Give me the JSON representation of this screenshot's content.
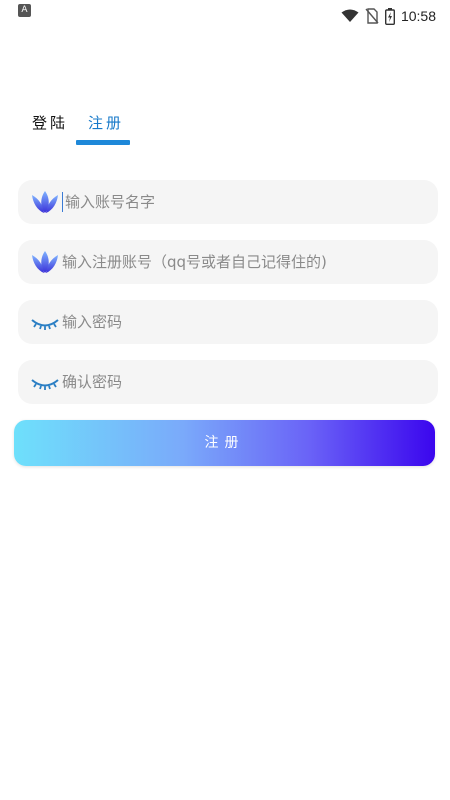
{
  "status_bar": {
    "app_badge": "A",
    "time": "10:58",
    "icons": [
      "wifi-icon",
      "no-sim-icon",
      "battery-charging-icon"
    ]
  },
  "tabs": [
    {
      "label": "登陆",
      "active": false
    },
    {
      "label": "注册",
      "active": true
    }
  ],
  "fields": {
    "account_name": {
      "placeholder": "输入账号名字",
      "icon": "lotus-icon"
    },
    "register_account": {
      "placeholder": "输入注册账号（qq号或者自己记得住的)",
      "icon": "lotus-icon"
    },
    "password": {
      "placeholder": "输入密码",
      "icon": "closed-eye-icon"
    },
    "confirm_password": {
      "placeholder": "确认密码",
      "icon": "closed-eye-icon"
    }
  },
  "submit_button": {
    "label": "注册"
  },
  "colors": {
    "accent": "#1e88d9",
    "gradient_start": "#6ee0fb",
    "gradient_end": "#3b06ee",
    "field_bg": "#f5f5f5"
  }
}
